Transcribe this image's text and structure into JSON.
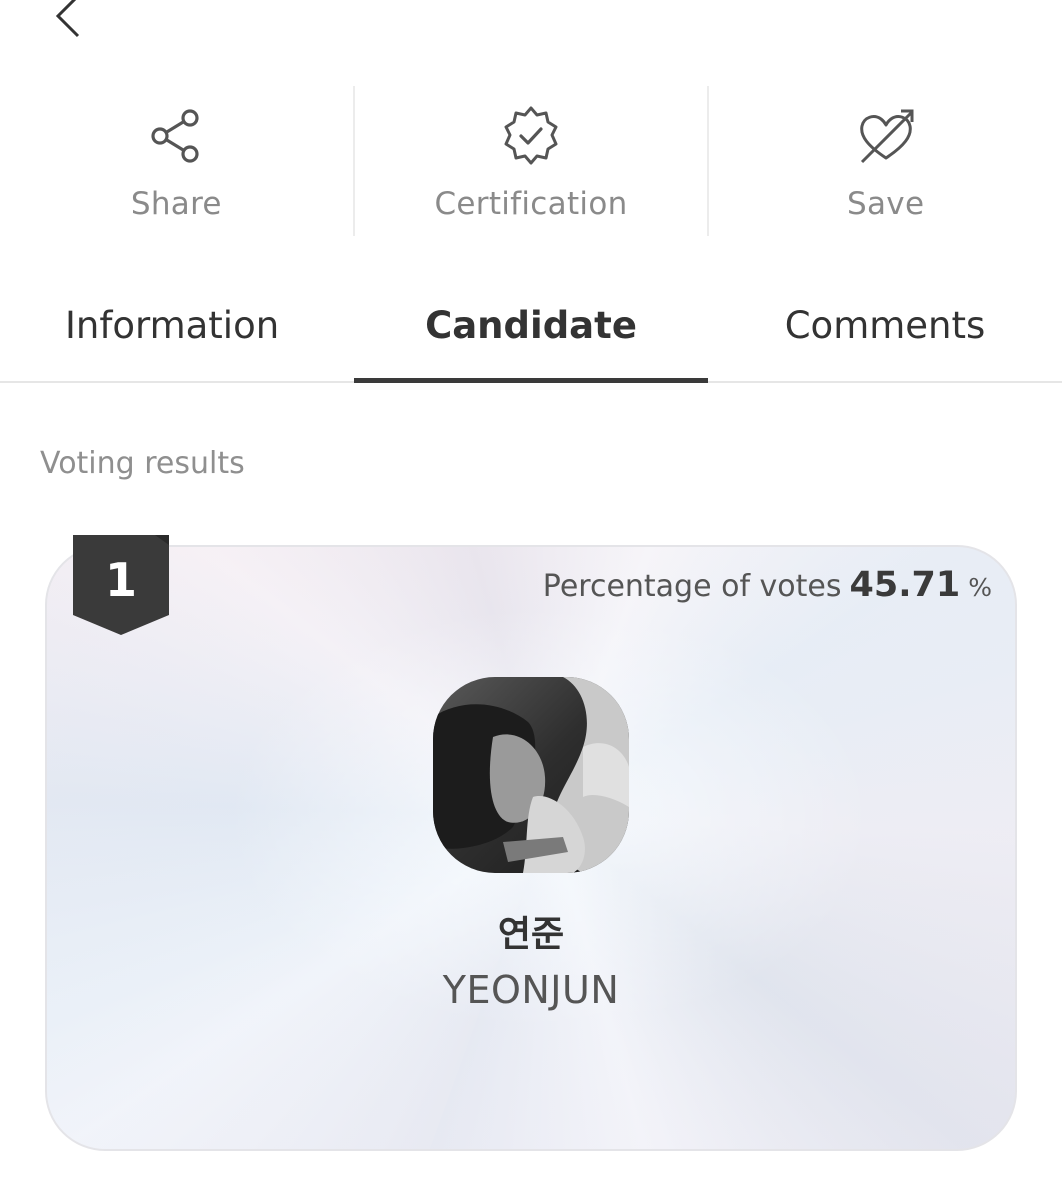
{
  "nav": {
    "back_icon": "chevron-left-icon"
  },
  "actions": [
    {
      "icon": "share-icon",
      "label": "Share"
    },
    {
      "icon": "certification-badge-icon",
      "label": "Certification"
    },
    {
      "icon": "heart-arrow-icon",
      "label": "Save"
    }
  ],
  "tabs": [
    {
      "label": "Information",
      "active": false
    },
    {
      "label": "Candidate",
      "active": true
    },
    {
      "label": "Comments",
      "active": false
    }
  ],
  "section": {
    "title": "Voting results"
  },
  "candidate": {
    "rank": "1",
    "percent_label": "Percentage of votes",
    "percent_value": "45.71",
    "percent_unit": "%",
    "name_ko": "연준",
    "name_en": "YEONJUN",
    "avatar": "candidate-photo"
  },
  "colors": {
    "badge": "#3a3a3a",
    "tab_indicator": "#3a3a3a",
    "muted_text": "#8a8a8a"
  }
}
